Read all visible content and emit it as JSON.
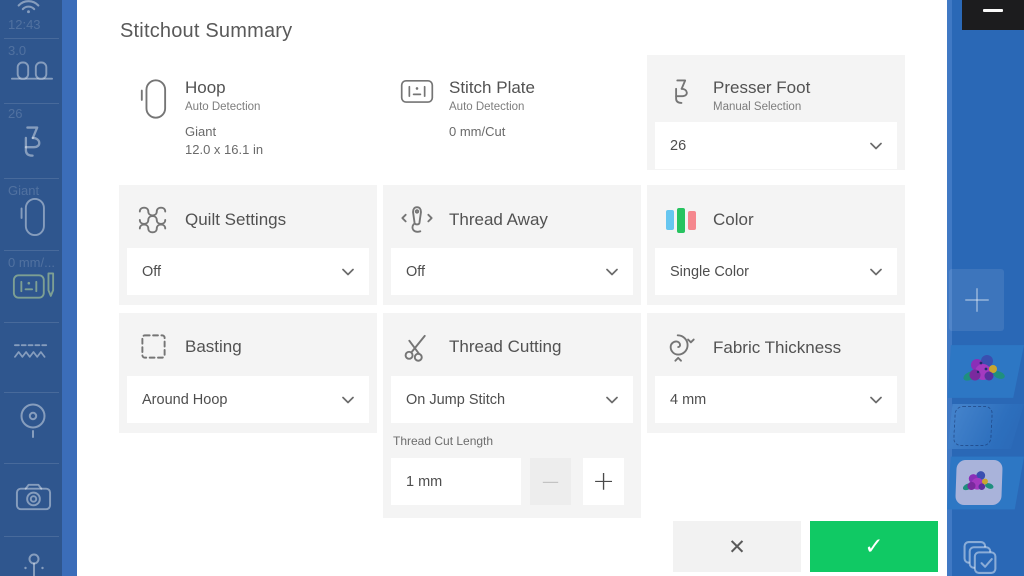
{
  "header": {
    "title": "Stitchout Summary"
  },
  "colors": {
    "confirm_green": "#10c964",
    "color_bars": [
      "#66c6f0",
      "#27c360",
      "#f5878e"
    ],
    "sidebar_left_bg": "#2f568e",
    "sidebar_right_bg": "#2a68b6"
  },
  "cards": {
    "hoop": {
      "title": "Hoop",
      "subtitle": "Auto Detection",
      "detail1": "Giant",
      "detail2": "12.0 x 16.1 in"
    },
    "stitch_plate": {
      "title": "Stitch Plate",
      "subtitle": "Auto Detection",
      "detail1": "0 mm/Cut"
    },
    "presser_foot": {
      "title": "Presser Foot",
      "subtitle": "Manual Selection",
      "value": "26"
    },
    "quilt_settings": {
      "title": "Quilt Settings",
      "value": "Off"
    },
    "thread_away": {
      "title": "Thread Away",
      "value": "Off"
    },
    "color": {
      "title": "Color",
      "value": "Single Color"
    },
    "basting": {
      "title": "Basting",
      "value": "Around Hoop"
    },
    "thread_cutting": {
      "title": "Thread Cutting",
      "value": "On Jump Stitch",
      "length_label": "Thread Cut Length",
      "length_value": "1 mm",
      "decrement": "—",
      "increment": "+"
    },
    "fabric_thickness": {
      "title": "Fabric Thickness",
      "value": "4 mm"
    }
  },
  "left_sidebar": {
    "labels": {
      "clock": "12:43",
      "tension": "3.0",
      "foot": "26",
      "hoop": "Giant",
      "plate": "0 mm/..."
    },
    "icons": [
      "wifi-icon",
      "thread-spools-icon",
      "presser-foot-icon",
      "hoop-icon",
      "stitch-plate-icon",
      "zigzag-stitches-icon",
      "bobbin-icon",
      "camera-icon",
      "needle-icon"
    ]
  },
  "right_sidebar": {
    "icons": [
      "minimize-icon",
      "plus-icon",
      "design-layer-preview",
      "basting-layer-preview",
      "mat-layer-preview",
      "layers-check-icon"
    ]
  },
  "footer": {
    "cancel": "✕",
    "confirm": "✓"
  }
}
